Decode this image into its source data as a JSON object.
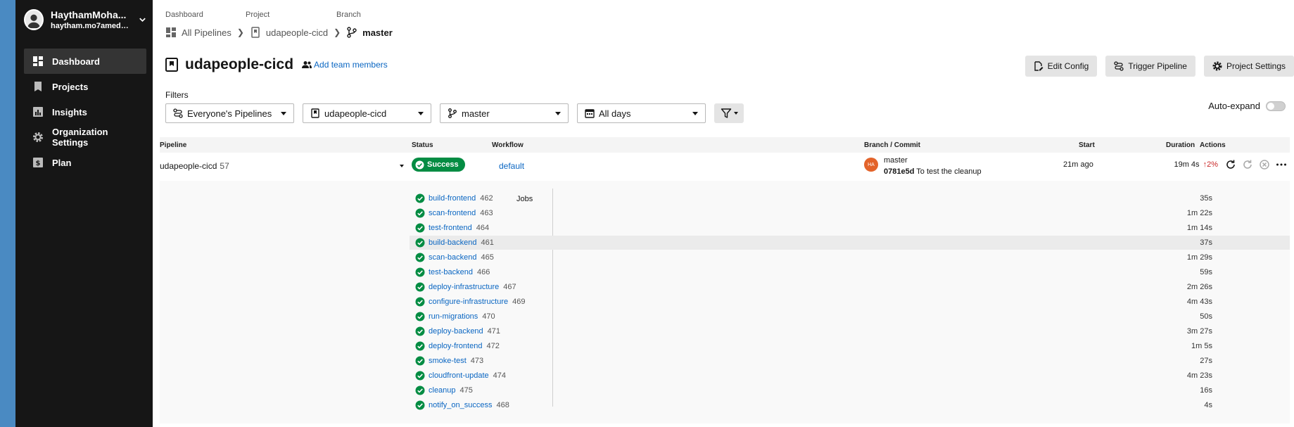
{
  "user": {
    "name": "HaythamMoha...",
    "email": "haytham.mo7amed@..."
  },
  "sidebar": {
    "items": [
      {
        "label": "Dashboard",
        "icon": "dashboard-icon",
        "active": true
      },
      {
        "label": "Projects",
        "icon": "bookmark-icon",
        "active": false
      },
      {
        "label": "Insights",
        "icon": "bar-chart-icon",
        "active": false
      },
      {
        "label": "Organization Settings",
        "icon": "gear-icon",
        "active": false
      },
      {
        "label": "Plan",
        "icon": "dollar-icon",
        "active": false
      }
    ]
  },
  "breadcrumb": {
    "labels": {
      "dashboard": "Dashboard",
      "project": "Project",
      "branch": "Branch"
    },
    "dashboard": "All Pipelines",
    "project": "udapeople-cicd",
    "branch": "master"
  },
  "header": {
    "title": "udapeople-cicd",
    "add_team": "Add team members",
    "edit_config": "Edit Config",
    "trigger_pipeline": "Trigger Pipeline",
    "project_settings": "Project Settings"
  },
  "filters": {
    "label": "Filters",
    "pipelines": "Everyone's Pipelines",
    "project": "udapeople-cicd",
    "branch": "master",
    "days": "All days",
    "auto_expand": "Auto-expand",
    "auto_expand_on": false
  },
  "table": {
    "headers": {
      "pipeline": "Pipeline",
      "status": "Status",
      "workflow": "Workflow",
      "branch_commit": "Branch / Commit",
      "start": "Start",
      "duration": "Duration",
      "actions": "Actions"
    },
    "pipeline": {
      "name": "udapeople-cicd",
      "number": "57",
      "status": "Success",
      "workflow": "default",
      "avatar_initials": "HA",
      "branch": "master",
      "commit_sha": "0781e5d",
      "commit_message": "To test the cleanup",
      "start": "21m ago",
      "duration": "19m 4s",
      "delta": "2%"
    },
    "jobs_label": "Jobs",
    "jobs": [
      {
        "name": "build-frontend",
        "number": "462",
        "duration": "35s"
      },
      {
        "name": "scan-frontend",
        "number": "463",
        "duration": "1m 22s"
      },
      {
        "name": "test-frontend",
        "number": "464",
        "duration": "1m 14s"
      },
      {
        "name": "build-backend",
        "number": "461",
        "duration": "37s"
      },
      {
        "name": "scan-backend",
        "number": "465",
        "duration": "1m 29s"
      },
      {
        "name": "test-backend",
        "number": "466",
        "duration": "59s"
      },
      {
        "name": "deploy-infrastructure",
        "number": "467",
        "duration": "2m 26s"
      },
      {
        "name": "configure-infrastructure",
        "number": "469",
        "duration": "4m 43s"
      },
      {
        "name": "run-migrations",
        "number": "470",
        "duration": "50s"
      },
      {
        "name": "deploy-backend",
        "number": "471",
        "duration": "3m 27s"
      },
      {
        "name": "deploy-frontend",
        "number": "472",
        "duration": "1m 5s"
      },
      {
        "name": "smoke-test",
        "number": "473",
        "duration": "27s"
      },
      {
        "name": "cloudfront-update",
        "number": "474",
        "duration": "4m 23s"
      },
      {
        "name": "cleanup",
        "number": "475",
        "duration": "16s"
      },
      {
        "name": "notify_on_success",
        "number": "468",
        "duration": "4s"
      }
    ]
  },
  "colors": {
    "sidebar_bg": "#161616",
    "success": "#048c43",
    "link": "#0a66c2",
    "delta_up": "#c92828",
    "avatar": "#e3632a"
  }
}
